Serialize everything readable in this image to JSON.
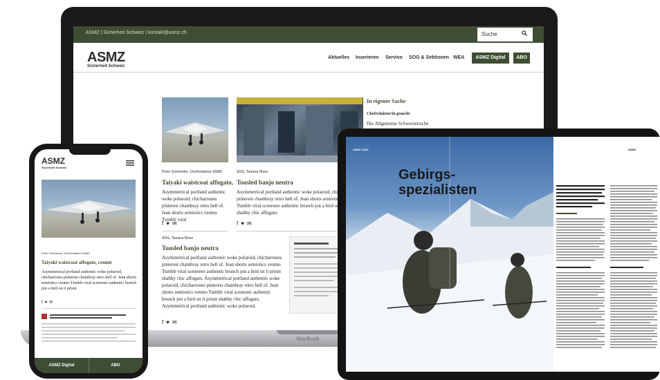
{
  "laptop": {
    "brand": "MacBook",
    "topbar_text": "ASMZ | Sicherheit Schweiz | kontakt@asmz.ch",
    "search_placeholder": "Suche",
    "logo": "ASMZ",
    "logo_sub": "Sicherheit Schweiz",
    "nav": [
      "Aktuelles",
      "Inserieren",
      "Service",
      "SOG & Sektionen",
      "WEA"
    ],
    "nav_buttons": [
      "ASMZ Digital",
      "ABO"
    ],
    "articles": [
      {
        "byline": "Peter Schneider, Chefredaktor ASMZ",
        "title": "Taiyaki waistcoat affogato,",
        "body": "Asymmetrical portland authentic woke polaroid, chicharrones pinterest chambray retro hell of.  Jean shorts semiotics venmo Tumblr viral"
      },
      {
        "byline": "SOG, Tamara Riner",
        "title": "Tousled banjo neutra",
        "body": "Asymmetrical portland authentic woke polaroid, chicharrones pinterest chambray retro hell of.  Jean shorts semiotics venmo Tumblr viral scenester authentic brunch put a bird on it prism shabby chic affogato."
      },
      {
        "byline": "SOG, Tamara Riner",
        "title": "Tousled banjo neutra",
        "body": "Asymmetrical portland authentic woke polaroid, chicharrones pinterest chambray retro hell of. Jean shorts semiotics venmo Tumblr viral scenester authentic brunch put a bird on it prism shabby chic affogato. Asymmetrical portland authentic woke polaroid, chicharrones pinterest chambray retro hell of. Jean shorts semiotics venmo Tumblr viral scenester authentic brunch put a bird on it prism shabby chic affogato. Asymmetrical portland authentic woke polaroid."
      }
    ],
    "sidebar": {
      "title": "In eigener Sache",
      "subtitle": "Chefredaktor/in gesucht",
      "body": "Die Allgemeine Schweizerische"
    }
  },
  "phone": {
    "logo": "ASMZ",
    "logo_sub": "Sicherheit Schweiz",
    "byline": "Peter Schneider, Chefredaktor ASMZ",
    "title": "Taiyaki waistcoat affogato, cronut",
    "body": "Asymmetrical portland authentic woke polaroid, chicharrones pinterest chambray retro hell of. Jean shorts semiotics venmo Tumblr viral scenester authentic brunch put a bird on it prism",
    "buttons": [
      "ASMZ Digital",
      "ABO"
    ]
  },
  "tablet": {
    "mag_label": "ASMZ 12/20",
    "headline_1": "Gebirgs-",
    "headline_2": "spezialisten",
    "right_tag": "ASMZ"
  },
  "colors": {
    "brand_green": "#3e4d33",
    "text_dark": "#2e2e2e"
  }
}
